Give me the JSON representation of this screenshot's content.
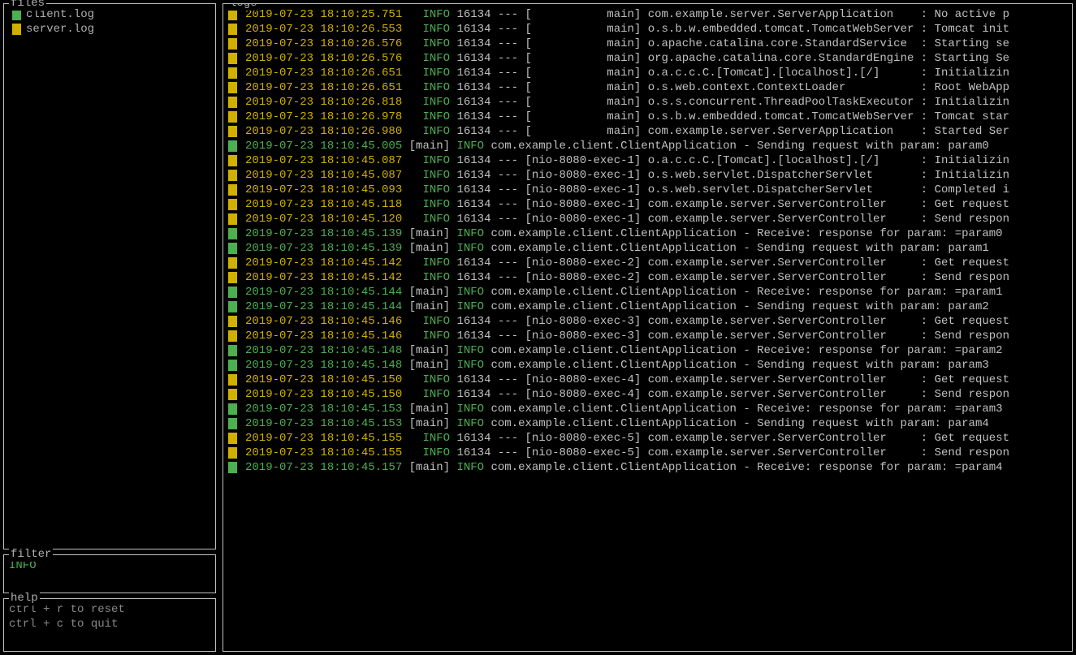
{
  "colors": {
    "client": "#4caf50",
    "server": "#d0b000"
  },
  "panels": {
    "files_title": "files",
    "filter_title": "filter",
    "help_title": "help",
    "logs_title": "logs"
  },
  "files": [
    {
      "name": "client.log",
      "color_key": "client"
    },
    {
      "name": "server.log",
      "color_key": "server"
    }
  ],
  "filter": {
    "value": "INFO"
  },
  "help": [
    "ctrl + r to reset",
    "ctrl + c to quit"
  ],
  "logs": [
    {
      "src": "server",
      "ts": "2019-07-23 18:10:25.751",
      "level": "INFO",
      "pid": "16134",
      "thread": "           main",
      "logger": "com.example.server.ServerApplication    ",
      "msg": ": No active p",
      "pad": "   "
    },
    {
      "src": "server",
      "ts": "2019-07-23 18:10:26.553",
      "level": "INFO",
      "pid": "16134",
      "thread": "           main",
      "logger": "o.s.b.w.embedded.tomcat.TomcatWebServer ",
      "msg": ": Tomcat init",
      "pad": "   "
    },
    {
      "src": "server",
      "ts": "2019-07-23 18:10:26.576",
      "level": "INFO",
      "pid": "16134",
      "thread": "           main",
      "logger": "o.apache.catalina.core.StandardService  ",
      "msg": ": Starting se",
      "pad": "   "
    },
    {
      "src": "server",
      "ts": "2019-07-23 18:10:26.576",
      "level": "INFO",
      "pid": "16134",
      "thread": "           main",
      "logger": "org.apache.catalina.core.StandardEngine ",
      "msg": ": Starting Se",
      "pad": "   "
    },
    {
      "src": "server",
      "ts": "2019-07-23 18:10:26.651",
      "level": "INFO",
      "pid": "16134",
      "thread": "           main",
      "logger": "o.a.c.c.C.[Tomcat].[localhost].[/]      ",
      "msg": ": Initializin",
      "pad": "   "
    },
    {
      "src": "server",
      "ts": "2019-07-23 18:10:26.651",
      "level": "INFO",
      "pid": "16134",
      "thread": "           main",
      "logger": "o.s.web.context.ContextLoader           ",
      "msg": ": Root WebApp",
      "pad": "   "
    },
    {
      "src": "server",
      "ts": "2019-07-23 18:10:26.818",
      "level": "INFO",
      "pid": "16134",
      "thread": "           main",
      "logger": "o.s.s.concurrent.ThreadPoolTaskExecutor ",
      "msg": ": Initializin",
      "pad": "   "
    },
    {
      "src": "server",
      "ts": "2019-07-23 18:10:26.978",
      "level": "INFO",
      "pid": "16134",
      "thread": "           main",
      "logger": "o.s.b.w.embedded.tomcat.TomcatWebServer ",
      "msg": ": Tomcat star",
      "pad": "   "
    },
    {
      "src": "server",
      "ts": "2019-07-23 18:10:26.980",
      "level": "INFO",
      "pid": "16134",
      "thread": "           main",
      "logger": "com.example.server.ServerApplication    ",
      "msg": ": Started Ser",
      "pad": "   "
    },
    {
      "src": "client",
      "ts": "2019-07-23 18:10:45.005",
      "style": "client",
      "thread": "main",
      "level": "INFO",
      "rest": "com.example.client.ClientApplication - Sending request with param: param0"
    },
    {
      "src": "server",
      "ts": "2019-07-23 18:10:45.087",
      "level": "INFO",
      "pid": "16134",
      "thread": "nio-8080-exec-1",
      "logger": "o.a.c.c.C.[Tomcat].[localhost].[/]      ",
      "msg": ": Initializin",
      "pad": "   "
    },
    {
      "src": "server",
      "ts": "2019-07-23 18:10:45.087",
      "level": "INFO",
      "pid": "16134",
      "thread": "nio-8080-exec-1",
      "logger": "o.s.web.servlet.DispatcherServlet       ",
      "msg": ": Initializin",
      "pad": "   "
    },
    {
      "src": "server",
      "ts": "2019-07-23 18:10:45.093",
      "level": "INFO",
      "pid": "16134",
      "thread": "nio-8080-exec-1",
      "logger": "o.s.web.servlet.DispatcherServlet       ",
      "msg": ": Completed i",
      "pad": "   "
    },
    {
      "src": "server",
      "ts": "2019-07-23 18:10:45.118",
      "level": "INFO",
      "pid": "16134",
      "thread": "nio-8080-exec-1",
      "logger": "com.example.server.ServerController     ",
      "msg": ": Get request",
      "pad": "   "
    },
    {
      "src": "server",
      "ts": "2019-07-23 18:10:45.120",
      "level": "INFO",
      "pid": "16134",
      "thread": "nio-8080-exec-1",
      "logger": "com.example.server.ServerController     ",
      "msg": ": Send respon",
      "pad": "   "
    },
    {
      "src": "client",
      "ts": "2019-07-23 18:10:45.139",
      "style": "client",
      "thread": "main",
      "level": "INFO",
      "rest": "com.example.client.ClientApplication - Receive: response for param: =param0"
    },
    {
      "src": "client",
      "ts": "2019-07-23 18:10:45.139",
      "style": "client",
      "thread": "main",
      "level": "INFO",
      "rest": "com.example.client.ClientApplication - Sending request with param: param1"
    },
    {
      "src": "server",
      "ts": "2019-07-23 18:10:45.142",
      "level": "INFO",
      "pid": "16134",
      "thread": "nio-8080-exec-2",
      "logger": "com.example.server.ServerController     ",
      "msg": ": Get request",
      "pad": "   "
    },
    {
      "src": "server",
      "ts": "2019-07-23 18:10:45.142",
      "level": "INFO",
      "pid": "16134",
      "thread": "nio-8080-exec-2",
      "logger": "com.example.server.ServerController     ",
      "msg": ": Send respon",
      "pad": "   "
    },
    {
      "src": "client",
      "ts": "2019-07-23 18:10:45.144",
      "style": "client",
      "thread": "main",
      "level": "INFO",
      "rest": "com.example.client.ClientApplication - Receive: response for param: =param1"
    },
    {
      "src": "client",
      "ts": "2019-07-23 18:10:45.144",
      "style": "client",
      "thread": "main",
      "level": "INFO",
      "rest": "com.example.client.ClientApplication - Sending request with param: param2"
    },
    {
      "src": "server",
      "ts": "2019-07-23 18:10:45.146",
      "level": "INFO",
      "pid": "16134",
      "thread": "nio-8080-exec-3",
      "logger": "com.example.server.ServerController     ",
      "msg": ": Get request",
      "pad": "   "
    },
    {
      "src": "server",
      "ts": "2019-07-23 18:10:45.146",
      "level": "INFO",
      "pid": "16134",
      "thread": "nio-8080-exec-3",
      "logger": "com.example.server.ServerController     ",
      "msg": ": Send respon",
      "pad": "   "
    },
    {
      "src": "client",
      "ts": "2019-07-23 18:10:45.148",
      "style": "client",
      "thread": "main",
      "level": "INFO",
      "rest": "com.example.client.ClientApplication - Receive: response for param: =param2"
    },
    {
      "src": "client",
      "ts": "2019-07-23 18:10:45.148",
      "style": "client",
      "thread": "main",
      "level": "INFO",
      "rest": "com.example.client.ClientApplication - Sending request with param: param3"
    },
    {
      "src": "server",
      "ts": "2019-07-23 18:10:45.150",
      "level": "INFO",
      "pid": "16134",
      "thread": "nio-8080-exec-4",
      "logger": "com.example.server.ServerController     ",
      "msg": ": Get request",
      "pad": "   "
    },
    {
      "src": "server",
      "ts": "2019-07-23 18:10:45.150",
      "level": "INFO",
      "pid": "16134",
      "thread": "nio-8080-exec-4",
      "logger": "com.example.server.ServerController     ",
      "msg": ": Send respon",
      "pad": "   "
    },
    {
      "src": "client",
      "ts": "2019-07-23 18:10:45.153",
      "style": "client",
      "thread": "main",
      "level": "INFO",
      "rest": "com.example.client.ClientApplication - Receive: response for param: =param3"
    },
    {
      "src": "client",
      "ts": "2019-07-23 18:10:45.153",
      "style": "client",
      "thread": "main",
      "level": "INFO",
      "rest": "com.example.client.ClientApplication - Sending request with param: param4"
    },
    {
      "src": "server",
      "ts": "2019-07-23 18:10:45.155",
      "level": "INFO",
      "pid": "16134",
      "thread": "nio-8080-exec-5",
      "logger": "com.example.server.ServerController     ",
      "msg": ": Get request",
      "pad": "   "
    },
    {
      "src": "server",
      "ts": "2019-07-23 18:10:45.155",
      "level": "INFO",
      "pid": "16134",
      "thread": "nio-8080-exec-5",
      "logger": "com.example.server.ServerController     ",
      "msg": ": Send respon",
      "pad": "   "
    },
    {
      "src": "client",
      "ts": "2019-07-23 18:10:45.157",
      "style": "client",
      "thread": "main",
      "level": "INFO",
      "rest": "com.example.client.ClientApplication - Receive: response for param: =param4"
    }
  ]
}
